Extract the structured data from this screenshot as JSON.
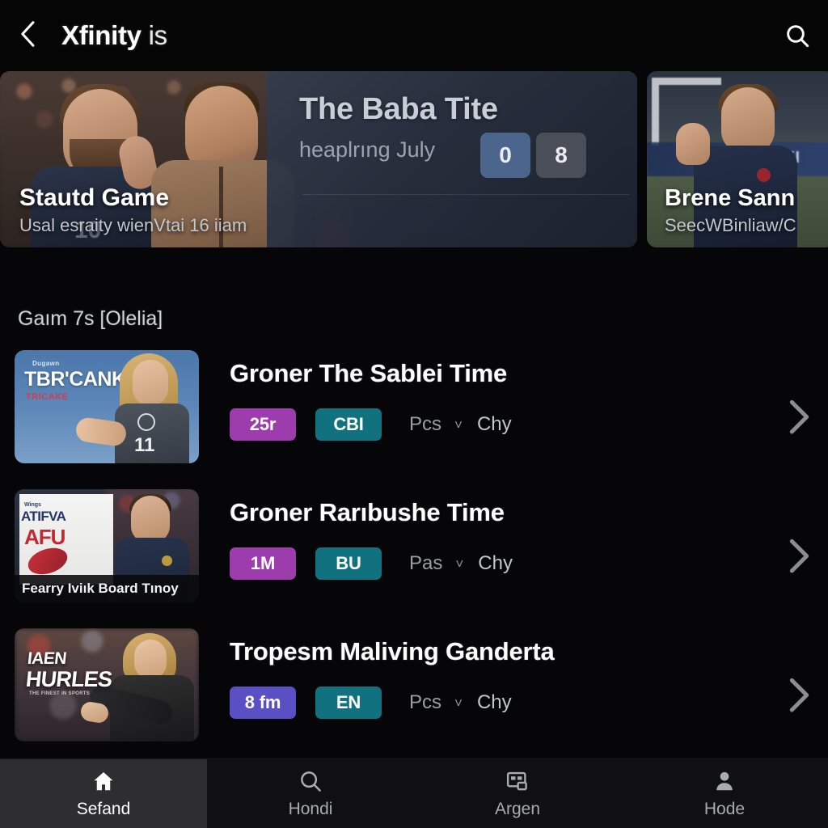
{
  "header": {
    "back_icon": "chevron-left-icon",
    "title_bold": "Xfinity",
    "title_rest": " is",
    "search_icon": "search-icon"
  },
  "carousel": {
    "cards": [
      {
        "title": "Stautd Game",
        "subtitle": "Usal esraity wienVtai 16 iiam",
        "panel_title": "The Baba Tite",
        "panel_subtitle": "heaplrıng July",
        "score_left": "0",
        "score_right": "8",
        "jersey_number": "10"
      },
      {
        "title": "Brene Sann",
        "subtitle": "SeecWBinliaw/C",
        "banner_text": "OT LAYI"
      }
    ]
  },
  "section": {
    "heading": "Gaım 7s [Olelia]"
  },
  "list": {
    "rows": [
      {
        "title": "Groner The Sablei Time",
        "badge_primary": "25r",
        "badge_primary_color": "#9c3cad",
        "badge_secondary": "CBI",
        "badge_secondary_color": "#12717f",
        "meta": "Pcs",
        "caret": "˅",
        "meta2": "Chy",
        "arrow_icon": "chevron-right-icon",
        "thumb": {
          "kind": "sky-athlete",
          "overline": "Dugawn",
          "logo": "TBR'CANK",
          "logo_sub": "TRICAKE",
          "number": "11"
        }
      },
      {
        "title": "Groner Rarıbushe Time",
        "badge_primary": "1M",
        "badge_primary_color": "#9c3cad",
        "badge_secondary": "BU",
        "badge_secondary_color": "#12717f",
        "meta": "Pas",
        "caret": "˅",
        "meta2": "Chy",
        "arrow_icon": "chevron-right-icon",
        "thumb": {
          "kind": "white-card-man",
          "overline": "Wings",
          "word1": "ATIFVA",
          "word2": "AFU",
          "caption": "Fearry Iviık Board Tınoy"
        }
      },
      {
        "title": "Tropesm Maliving Ganderta",
        "badge_primary": "8 fm",
        "badge_primary_color": "#5b4fc4",
        "badge_secondary": "EN",
        "badge_secondary_color": "#12717f",
        "meta": "Pcs",
        "caret": "˅",
        "meta2": "Chy",
        "arrow_icon": "chevron-right-icon",
        "thumb": {
          "kind": "crowd-woman",
          "word1": "IAEN",
          "word2": "HURLES",
          "word3": "THE FINEST IN SPORTS"
        }
      }
    ]
  },
  "bottom_nav": {
    "items": [
      {
        "label": "Sefand",
        "icon": "home-icon",
        "active": true
      },
      {
        "label": "Hondi",
        "icon": "search-icon",
        "active": false
      },
      {
        "label": "Argen",
        "icon": "news-card-icon",
        "active": false
      },
      {
        "label": "Hode",
        "icon": "person-icon",
        "active": false
      }
    ]
  }
}
